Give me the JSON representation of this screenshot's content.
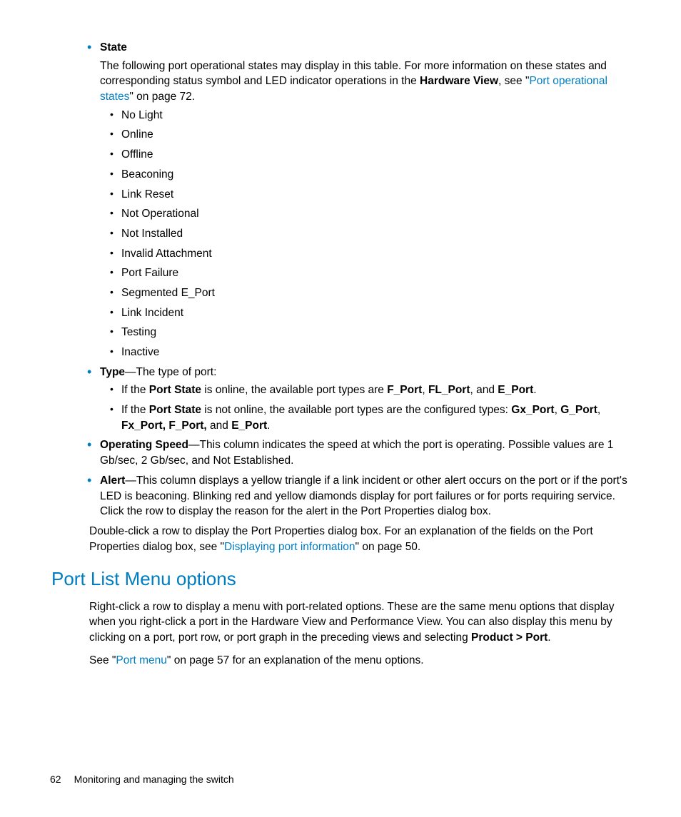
{
  "bullets": {
    "state": {
      "label": "State",
      "intro_a": "The following port operational states may display in this table. For more information on these states and corresponding status symbol and LED indicator operations in the ",
      "hardware_view": "Hardware View",
      "intro_b": ", see \"",
      "link": "Port operational states",
      "intro_c": "\" on page 72.",
      "items": [
        "No Light",
        "Online",
        "Offline",
        "Beaconing",
        "Link Reset",
        "Not Operational",
        "Not Installed",
        "Invalid Attachment",
        "Port Failure",
        "Segmented E_Port",
        "Link Incident",
        "Testing",
        "Inactive"
      ]
    },
    "type": {
      "label": "Type",
      "dash_text": "—The type of port:",
      "sub1_a": "If the ",
      "sub1_b": "Port State",
      "sub1_c": " is online, the available port types are ",
      "sub1_d": "F_Port",
      "sub1_e": ", ",
      "sub1_f": "FL_Port",
      "sub1_g": ", and ",
      "sub1_h": "E_Port",
      "sub1_i": ".",
      "sub2_a": "If the ",
      "sub2_b": "Port State",
      "sub2_c": " is not online, the available port types are the configured types: ",
      "sub2_d": "Gx_Port",
      "sub2_e": ", ",
      "sub2_f": "G_Port",
      "sub2_g": ", ",
      "sub2_h": "Fx_Port, F_Port,",
      "sub2_i": " and ",
      "sub2_j": "E_Port",
      "sub2_k": "."
    },
    "opspeed": {
      "label": "Operating Speed",
      "text": "—This column indicates the speed at which the port is operating. Possible values are 1 Gb/sec, 2 Gb/sec, and Not Established."
    },
    "alert": {
      "label": "Alert",
      "text": "—This column displays a yellow triangle if a link incident or other alert occurs on the port or if the port's LED is beaconing. Blinking red and yellow diamonds display for port failures or for ports requiring service. Click the row to display the reason for the alert in the Port Properties dialog box."
    }
  },
  "paragraph1_a": "Double-click a row to display the Port Properties dialog box. For an explanation of the fields on the Port Properties dialog box, see \"",
  "paragraph1_link": "Displaying port information",
  "paragraph1_b": "\" on page 50.",
  "section_heading": "Port List Menu options",
  "paragraph2_a": "Right-click a row to display a menu with port-related options. These are the same menu options that display when you right-click a port in the Hardware View and Performance View. You can also display this menu by clicking on a port, port row, or port graph in the preceding views and selecting ",
  "paragraph2_b": "Product > Port",
  "paragraph2_c": ".",
  "paragraph3_a": "See \"",
  "paragraph3_link": "Port menu",
  "paragraph3_b": "\" on page 57 for an explanation of the menu options.",
  "footer": {
    "page": "62",
    "title": "Monitoring and managing the switch"
  }
}
